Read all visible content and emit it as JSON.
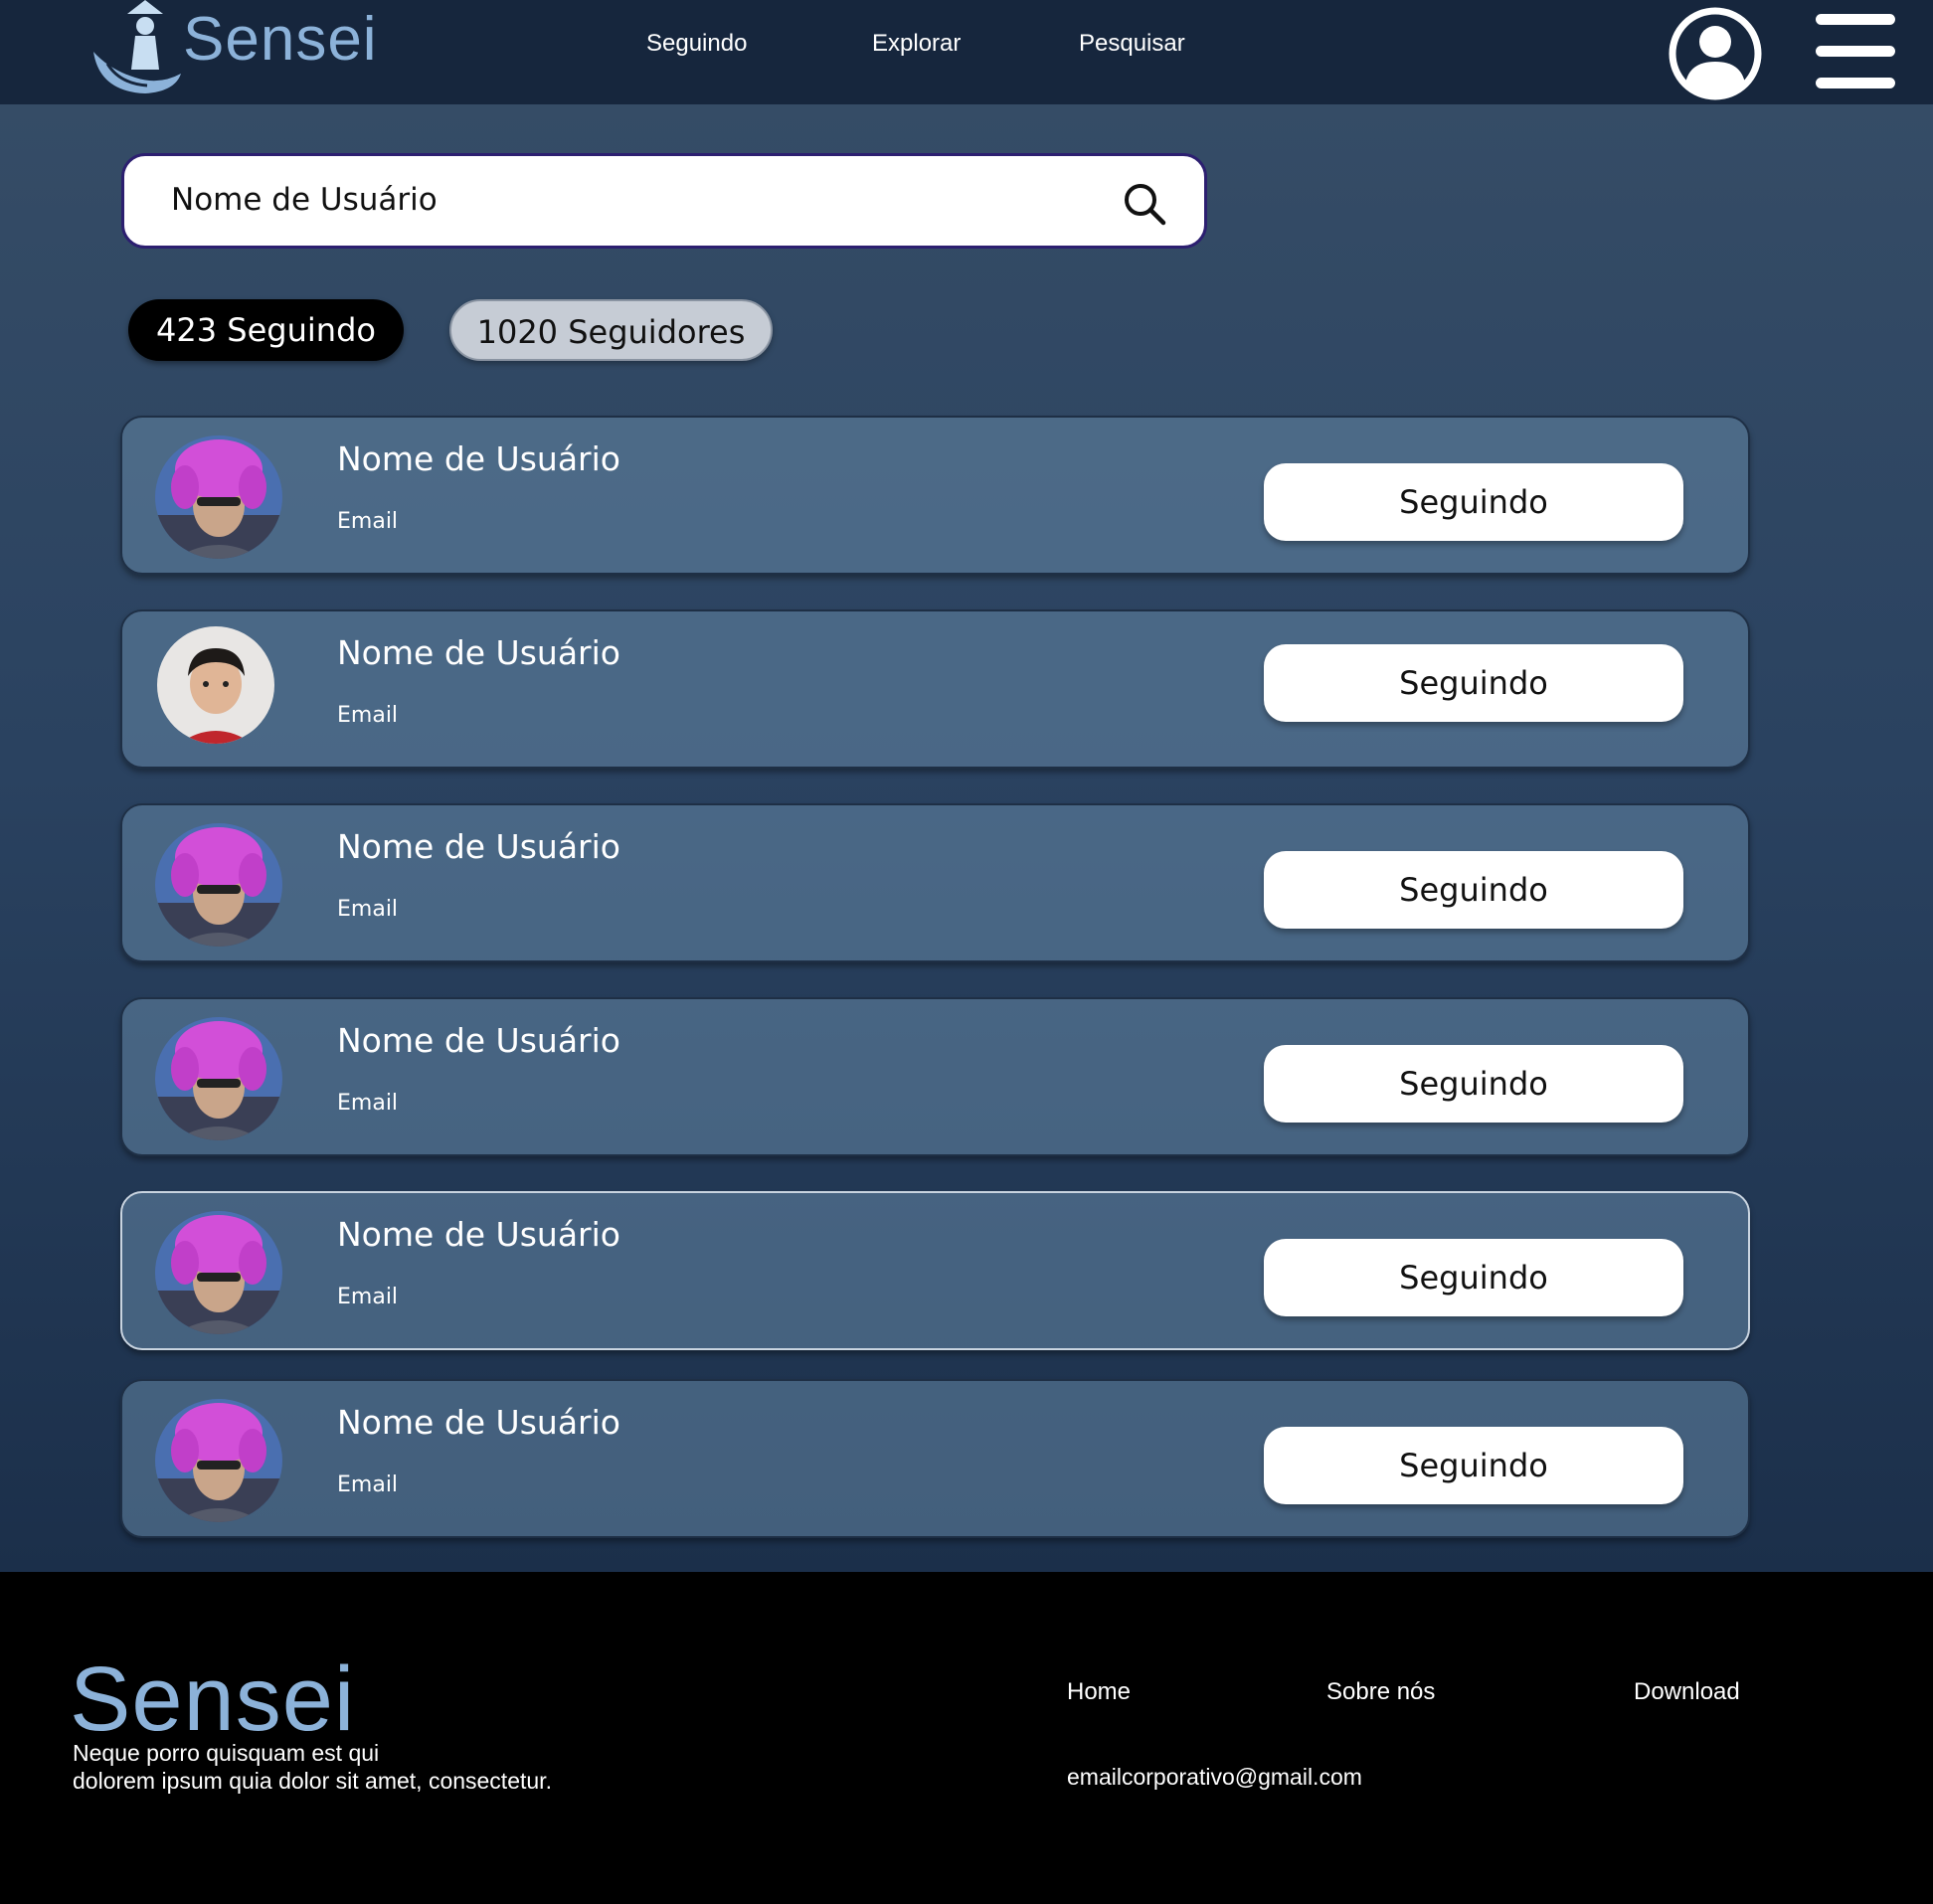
{
  "header": {
    "brand": "Sensei",
    "nav": [
      {
        "label": "Seguindo"
      },
      {
        "label": "Explorar"
      },
      {
        "label": "Pesquisar"
      }
    ],
    "profile_icon": "user-circle-icon",
    "menu_icon": "hamburger-menu-icon"
  },
  "search": {
    "value": "Nome de Usuário",
    "icon": "search-icon"
  },
  "tabs": {
    "following": "423 Seguindo",
    "followers": "1020 Seguidores"
  },
  "users": [
    {
      "name": "Nome de Usuário",
      "email": "Email",
      "button": "Seguindo",
      "avatar": "avatar-pink-hair"
    },
    {
      "name": "Nome de Usuário",
      "email": "Email",
      "button": "Seguindo",
      "avatar": "avatar-boy"
    },
    {
      "name": "Nome de Usuário",
      "email": "Email",
      "button": "Seguindo",
      "avatar": "avatar-pink-hair"
    },
    {
      "name": "Nome de Usuário",
      "email": "Email",
      "button": "Seguindo",
      "avatar": "avatar-pink-hair"
    },
    {
      "name": "Nome de Usuário",
      "email": "Email",
      "button": "Seguindo",
      "avatar": "avatar-pink-hair"
    },
    {
      "name": "Nome de Usuário",
      "email": "Email",
      "button": "Seguindo",
      "avatar": "avatar-pink-hair"
    }
  ],
  "footer": {
    "brand": "Sensei",
    "tagline_line1": "Neque porro quisquam est qui",
    "tagline_line2": "dolorem ipsum quia dolor sit amet, consectetur.",
    "links": [
      {
        "label": "Home"
      },
      {
        "label": "Sobre nós"
      },
      {
        "label": "Download"
      }
    ],
    "email": "emailcorporativo@gmail.com"
  },
  "colors": {
    "header_bg": "#16263d",
    "brand": "#8cb2d9",
    "footer_bg": "#000000"
  }
}
